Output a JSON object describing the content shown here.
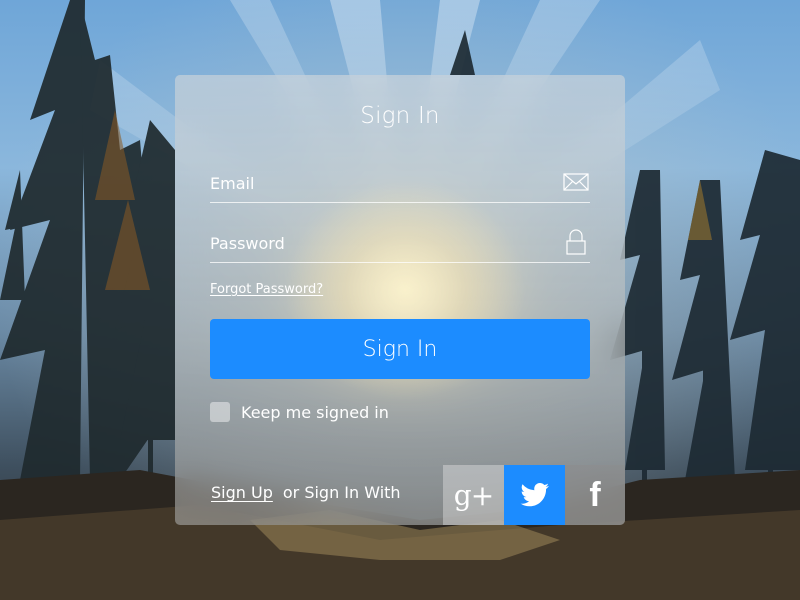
{
  "login": {
    "title": "Sign In",
    "email_placeholder": "Email",
    "password_placeholder": "Password",
    "forgot_password": "Forgot Password?",
    "submit_label": "Sign In",
    "keep_signed_in": "Keep me signed in",
    "keep_signed_in_checked": false,
    "signup_link": "Sign Up",
    "or_sign_in_with": "or Sign In With"
  },
  "social": [
    {
      "name": "google-plus",
      "icon": "google-plus-icon",
      "glyph": "g+",
      "color": "#e1e1e1"
    },
    {
      "name": "twitter",
      "icon": "twitter-bird-icon",
      "color": "#1c8cff"
    },
    {
      "name": "facebook",
      "icon": "facebook-icon",
      "glyph": "f",
      "color": "#8c8c8c"
    }
  ],
  "icons": {
    "email": "envelope-icon",
    "password": "padlock-icon"
  },
  "colors": {
    "accent": "#1c8cff",
    "text": "#ffffff"
  }
}
